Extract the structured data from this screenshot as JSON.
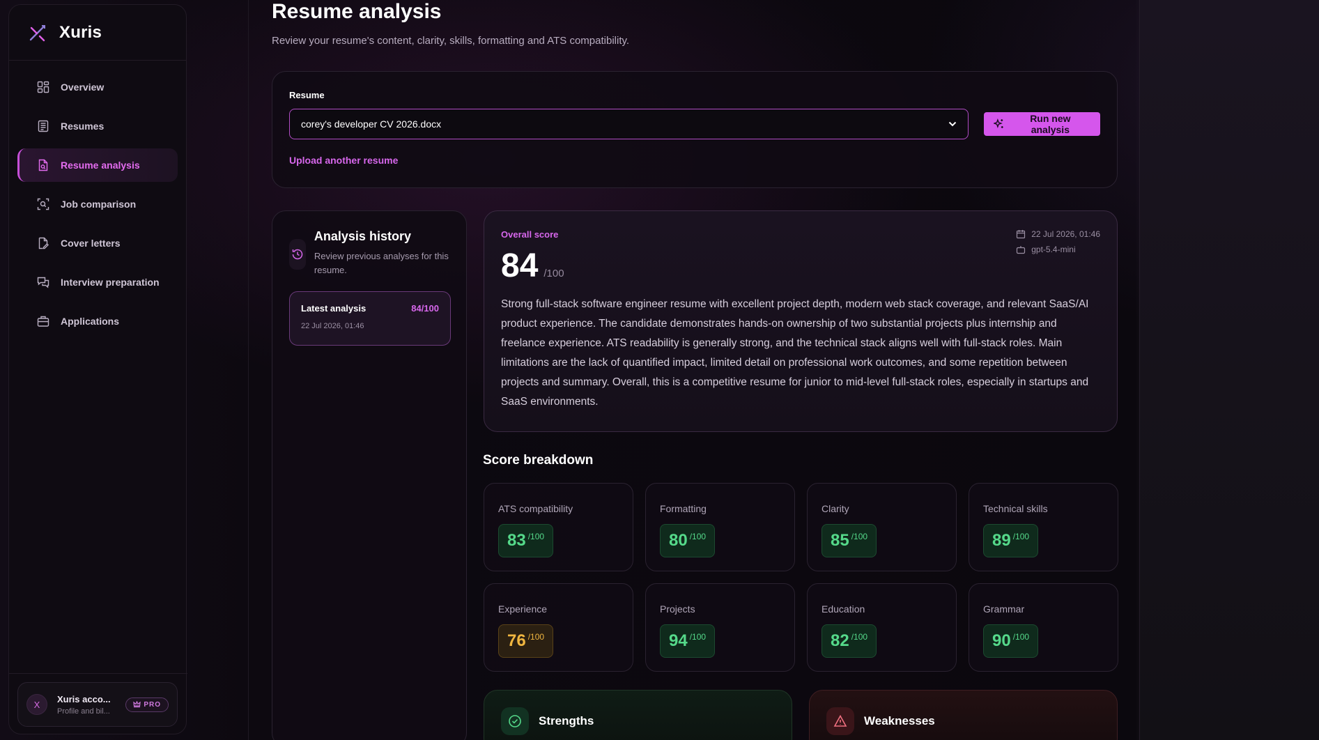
{
  "brand": {
    "name": "Xuris"
  },
  "sidebar": {
    "items": [
      {
        "label": "Overview",
        "icon": "grid-icon"
      },
      {
        "label": "Resumes",
        "icon": "document-list-icon"
      },
      {
        "label": "Resume analysis",
        "icon": "document-search-icon"
      },
      {
        "label": "Job comparison",
        "icon": "scan-icon"
      },
      {
        "label": "Cover letters",
        "icon": "document-edit-icon"
      },
      {
        "label": "Interview preparation",
        "icon": "chat-icon"
      },
      {
        "label": "Applications",
        "icon": "briefcase-icon"
      }
    ]
  },
  "account": {
    "initial": "X",
    "name": "Xuris acco...",
    "sub": "Profile and bil...",
    "badge": "PRO"
  },
  "page": {
    "title": "Resume analysis",
    "subtitle": "Review your resume's content, clarity, skills, formatting and ATS compatibility."
  },
  "resume": {
    "label": "Resume",
    "selected": "corey's developer CV 2026.docx",
    "run_button": "Run new analysis",
    "upload_link": "Upload another resume"
  },
  "history": {
    "title": "Analysis history",
    "subtitle": "Review previous analyses for this resume.",
    "items": [
      {
        "name": "Latest analysis",
        "score": "84/100",
        "date": "22 Jul 2026, 01:46"
      }
    ]
  },
  "overall": {
    "label": "Overall score",
    "score": "84",
    "max": "/100",
    "date": "22 Jul 2026, 01:46",
    "model": "gpt-5.4-mini",
    "summary": "Strong full-stack software engineer resume with excellent project depth, modern web stack coverage, and relevant SaaS/AI product experience. The candidate demonstrates hands-on ownership of two substantial projects plus internship and freelance experience. ATS readability is generally strong, and the technical stack aligns well with full-stack roles. Main limitations are the lack of quantified impact, limited detail on professional work outcomes, and some repetition between projects and summary. Overall, this is a competitive resume for junior to mid-level full-stack roles, especially in startups and SaaS environments."
  },
  "breakdown": {
    "title": "Score breakdown",
    "max": "/100",
    "items": [
      {
        "label": "ATS compatibility",
        "value": "83",
        "tone": "green"
      },
      {
        "label": "Formatting",
        "value": "80",
        "tone": "green"
      },
      {
        "label": "Clarity",
        "value": "85",
        "tone": "green"
      },
      {
        "label": "Technical skills",
        "value": "89",
        "tone": "green"
      },
      {
        "label": "Experience",
        "value": "76",
        "tone": "amber"
      },
      {
        "label": "Projects",
        "value": "94",
        "tone": "green"
      },
      {
        "label": "Education",
        "value": "82",
        "tone": "green"
      },
      {
        "label": "Grammar",
        "value": "90",
        "tone": "green"
      }
    ]
  },
  "strengths": {
    "title": "Strengths"
  },
  "weaknesses": {
    "title": "Weaknesses"
  },
  "colors": {
    "accent": "#d556ec",
    "good": "#55d98a",
    "warn": "#f0b640"
  }
}
